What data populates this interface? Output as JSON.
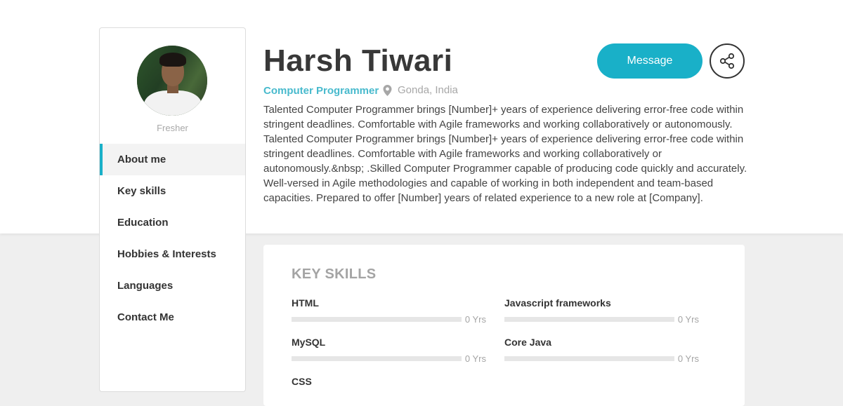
{
  "profile": {
    "name": "Harsh Tiwari",
    "job_title": "Computer Programmer",
    "location": "Gonda, India",
    "status": "Fresher",
    "bio": "Talented Computer Programmer brings [Number]+ years of experience delivering error-free code within stringent deadlines. Comfortable with Agile frameworks and working collaboratively or autonomously. Talented Computer Programmer brings [Number]+ years of experience delivering error-free code within stringent deadlines. Comfortable with Agile frameworks and working collaboratively or autonomously.&nbsp; .Skilled Computer Programmer capable of producing code quickly and accurately. Well-versed in Agile methodologies and capable of working in both independent and team-based capacities. Prepared to offer [Number] years of related experience to a new role at [Company]."
  },
  "actions": {
    "message_label": "Message",
    "share_icon": "share-icon"
  },
  "sidebar": {
    "items": [
      {
        "label": "About me",
        "active": true
      },
      {
        "label": "Key skills",
        "active": false
      },
      {
        "label": "Education",
        "active": false
      },
      {
        "label": "Hobbies & Interests",
        "active": false
      },
      {
        "label": "Languages",
        "active": false
      },
      {
        "label": "Contact Me",
        "active": false
      }
    ]
  },
  "skills": {
    "title": "KEY SKILLS",
    "items": [
      {
        "name": "HTML",
        "years": "0 Yrs",
        "level": 0
      },
      {
        "name": "Javascript frameworks",
        "years": "0 Yrs",
        "level": 0
      },
      {
        "name": "MySQL",
        "years": "0 Yrs",
        "level": 0
      },
      {
        "name": "Core Java",
        "years": "0 Yrs",
        "level": 0
      },
      {
        "name": "CSS",
        "years": "",
        "level": 0
      }
    ]
  },
  "colors": {
    "accent": "#19b0c8",
    "accent_text": "#48bacd",
    "text_dark": "#383838",
    "muted": "#a7a7a7"
  }
}
